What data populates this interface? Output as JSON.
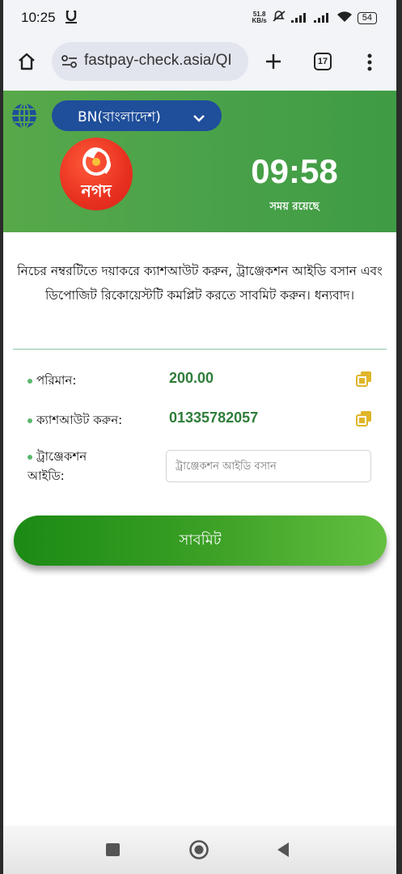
{
  "status_bar": {
    "time": "10:25",
    "app_icon": "notification-app-icon",
    "network_speed_value": "51.8",
    "network_speed_unit": "KB/s",
    "battery": "54"
  },
  "browser": {
    "url": "fastpay-check.asia/QI",
    "tab_count": "17"
  },
  "header": {
    "language": "BN(বাংলাদেশ)",
    "logo_text": "নগদ",
    "timer": "09:58",
    "timer_label": "সময় রয়েছে",
    "colors": {
      "header_green": "#4aa24a",
      "language_pill": "#1f4e9a",
      "logo_red": "#e8301f"
    }
  },
  "instruction": "নিচের নম্বরটিতে দয়াকরে ক্যাশআউট করুন, ট্রাঞ্জেকশন আইডি বসান এবং ডিপোজিট রিকোয়েস্টটি কমপ্লিট করতে সাবমিট করুন। ধন্যবাদ।",
  "details": {
    "amount_label": "পরিমান:",
    "amount_value": "200.00",
    "cashout_label": "ক্যাশআউট করুন:",
    "cashout_number": "01335782057",
    "txn_label_line1": "ট্রাঞ্জেকশন",
    "txn_label_line2": "আইডি:",
    "txn_placeholder": "ট্রাঞ্জেকশন আইডি বসান",
    "txn_value": ""
  },
  "submit_label": "সাবমিট"
}
